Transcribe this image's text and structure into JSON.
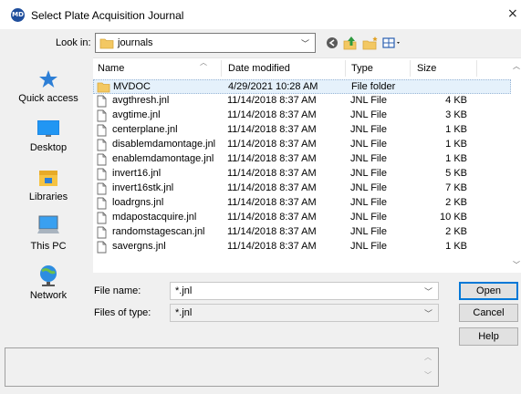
{
  "window": {
    "title": "Select Plate Acquisition Journal",
    "icon_text": "MD",
    "close_glyph": "×"
  },
  "lookin": {
    "label": "Look in:",
    "value": "journals"
  },
  "places": [
    {
      "label": "Quick access",
      "icon": "star-icon"
    },
    {
      "label": "Desktop",
      "icon": "desktop-icon"
    },
    {
      "label": "Libraries",
      "icon": "libraries-icon"
    },
    {
      "label": "This PC",
      "icon": "computer-icon"
    },
    {
      "label": "Network",
      "icon": "network-icon"
    }
  ],
  "columns": [
    "Name",
    "Date modified",
    "Type",
    "Size"
  ],
  "files": [
    {
      "name": "MVDOC",
      "date": "4/29/2021 10:28 AM",
      "type": "File folder",
      "size": "",
      "icon": "folder-icon"
    },
    {
      "name": "avgthresh.jnl",
      "date": "11/14/2018 8:37 AM",
      "type": "JNL File",
      "size": "4 KB",
      "icon": "file-icon"
    },
    {
      "name": "avgtime.jnl",
      "date": "11/14/2018 8:37 AM",
      "type": "JNL File",
      "size": "3 KB",
      "icon": "file-icon"
    },
    {
      "name": "centerplane.jnl",
      "date": "11/14/2018 8:37 AM",
      "type": "JNL File",
      "size": "1 KB",
      "icon": "file-icon"
    },
    {
      "name": "disablemdamontage.jnl",
      "date": "11/14/2018 8:37 AM",
      "type": "JNL File",
      "size": "1 KB",
      "icon": "file-icon"
    },
    {
      "name": "enablemdamontage.jnl",
      "date": "11/14/2018 8:37 AM",
      "type": "JNL File",
      "size": "1 KB",
      "icon": "file-icon"
    },
    {
      "name": "invert16.jnl",
      "date": "11/14/2018 8:37 AM",
      "type": "JNL File",
      "size": "5 KB",
      "icon": "file-icon"
    },
    {
      "name": "invert16stk.jnl",
      "date": "11/14/2018 8:37 AM",
      "type": "JNL File",
      "size": "7 KB",
      "icon": "file-icon"
    },
    {
      "name": "loadrgns.jnl",
      "date": "11/14/2018 8:37 AM",
      "type": "JNL File",
      "size": "2 KB",
      "icon": "file-icon"
    },
    {
      "name": "mdapostacquire.jnl",
      "date": "11/14/2018 8:37 AM",
      "type": "JNL File",
      "size": "10 KB",
      "icon": "file-icon"
    },
    {
      "name": "randomstagescan.jnl",
      "date": "11/14/2018 8:37 AM",
      "type": "JNL File",
      "size": "2 KB",
      "icon": "file-icon"
    },
    {
      "name": "savergns.jnl",
      "date": "11/14/2018 8:37 AM",
      "type": "JNL File",
      "size": "1 KB",
      "icon": "file-icon"
    }
  ],
  "filename": {
    "label": "File name:",
    "value": "*.jnl"
  },
  "filetype": {
    "label": "Files of type:",
    "value": "*.jnl"
  },
  "buttons": {
    "open": "Open",
    "cancel": "Cancel",
    "help": "Help"
  },
  "colors": {
    "selection": "#e5f1fb",
    "folder": "#e8b84a",
    "default_button_border": "#0078d7"
  }
}
